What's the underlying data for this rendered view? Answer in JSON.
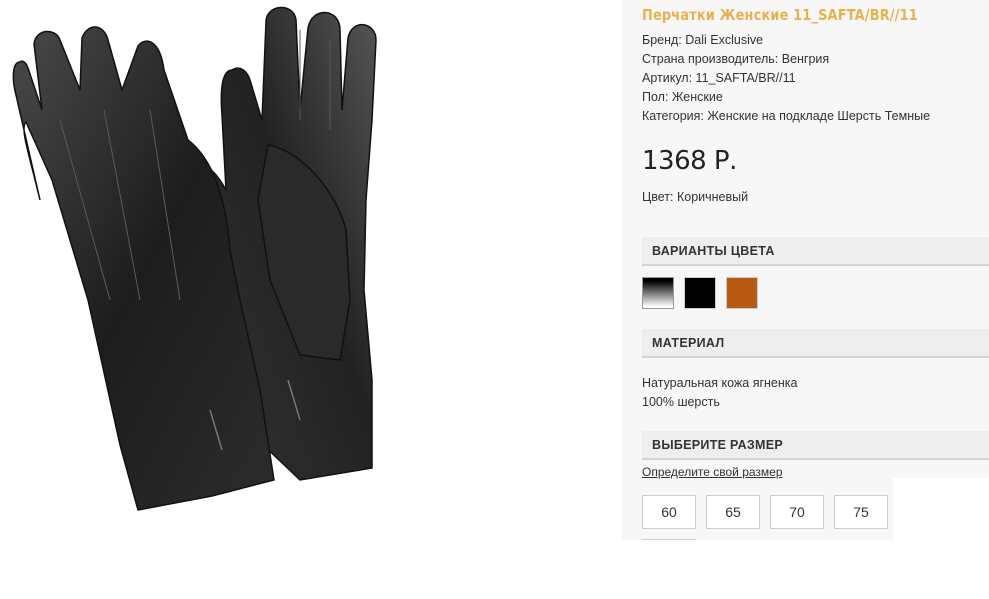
{
  "product": {
    "title": "Перчатки Женские 11_SAFTA/BR//11",
    "image_alt": "Кожаные перчатки",
    "specs": [
      "Бренд: Dali Exclusive",
      "Страна производитель: Венгрия",
      "Артикул: 11_SAFTA/BR//11",
      "Пол: Женские",
      "Категория: Женские на подкладе Шерсть Темные"
    ],
    "price": "1368 Р.",
    "color": "Цвет: Коричневый"
  },
  "colors": {
    "header": "ВАРИАНТЫ ЦВЕТА",
    "swatches": [
      {
        "name": "gradient",
        "color": "#000000"
      },
      {
        "name": "black",
        "color": "#000000"
      },
      {
        "name": "brown",
        "color": "#b85a12"
      }
    ]
  },
  "material": {
    "header": "МАТЕРИАЛ",
    "lines": [
      "Натуральная кожа ягненка",
      "100% шерсть"
    ]
  },
  "size": {
    "header": "ВЫБЕРИТЕ РАЗМЕР",
    "link": "Определите свой размер",
    "options": [
      "60",
      "65",
      "70",
      "75"
    ]
  },
  "theme": {
    "title_color": "#e7b14c",
    "panel_bg": "#f7f7f7",
    "header_bg": "#eeeeee"
  }
}
